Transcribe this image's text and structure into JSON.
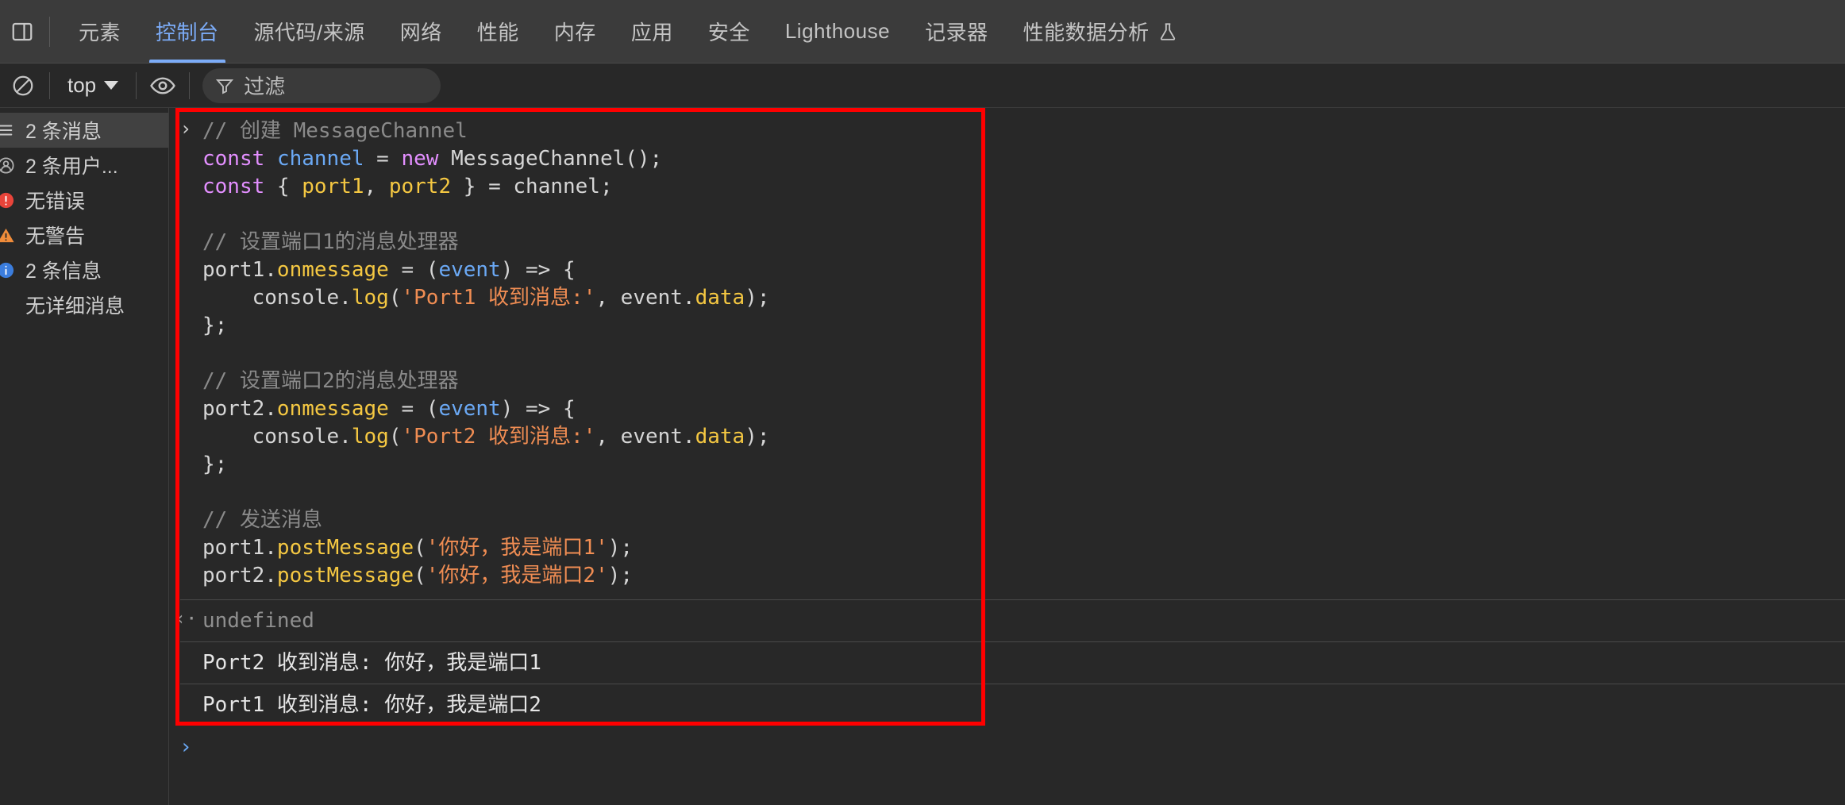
{
  "window": {
    "app": "Chrome DevTools",
    "background": "#282828",
    "accent": "#7cacf8",
    "highlight_color": "#ff0000"
  },
  "tabbar": {
    "dock_icon": "dock-panel-icon",
    "tabs": [
      {
        "label": "元素",
        "name": "tab-elements",
        "selected": false
      },
      {
        "label": "控制台",
        "name": "tab-console",
        "selected": true
      },
      {
        "label": "源代码/来源",
        "name": "tab-sources",
        "selected": false
      },
      {
        "label": "网络",
        "name": "tab-network",
        "selected": false
      },
      {
        "label": "性能",
        "name": "tab-performance",
        "selected": false
      },
      {
        "label": "内存",
        "name": "tab-memory",
        "selected": false
      },
      {
        "label": "应用",
        "name": "tab-application",
        "selected": false
      },
      {
        "label": "安全",
        "name": "tab-security",
        "selected": false
      },
      {
        "label": "Lighthouse",
        "name": "tab-lighthouse",
        "selected": false
      },
      {
        "label": "记录器",
        "name": "tab-recorder",
        "selected": false
      },
      {
        "label": "性能数据分析",
        "name": "tab-performance-insights",
        "selected": false,
        "icon": "flask-icon"
      }
    ]
  },
  "toolbar": {
    "clear_icon": "clear-console-icon",
    "context_value": "top",
    "context_caret": "chevron-down-icon",
    "eye_icon": "live-expression-eye-icon",
    "filter_icon": "filter-funnel-icon",
    "filter_placeholder": "过滤"
  },
  "sidebar": {
    "items": [
      {
        "label": "2 条消息",
        "name": "sidebar-item-messages",
        "icon": "list-icon",
        "selected": true
      },
      {
        "label": "2 条用户...",
        "name": "sidebar-item-user",
        "icon": "user-icon",
        "selected": false
      },
      {
        "label": "无错误",
        "name": "sidebar-item-errors",
        "icon": "error-icon",
        "selected": false
      },
      {
        "label": "无警告",
        "name": "sidebar-item-warnings",
        "icon": "warning-icon",
        "selected": false
      },
      {
        "label": "2 条信息",
        "name": "sidebar-item-info",
        "icon": "info-icon",
        "selected": false
      },
      {
        "label": "无详细消息",
        "name": "sidebar-item-verbose",
        "icon": "none",
        "selected": false
      }
    ]
  },
  "console": {
    "input_chevron": "›",
    "output_chevron": "‹·",
    "prompt_chevron": "›",
    "code_lines": [
      [
        {
          "t": "// 创建 MessageChannel",
          "c": "comment"
        }
      ],
      [
        {
          "t": "const",
          "c": "kw"
        },
        {
          "t": " ",
          "c": "plain"
        },
        {
          "t": "channel",
          "c": "ident"
        },
        {
          "t": " = ",
          "c": "plain"
        },
        {
          "t": "new",
          "c": "kw"
        },
        {
          "t": " MessageChannel();",
          "c": "plain"
        }
      ],
      [
        {
          "t": "const",
          "c": "kw"
        },
        {
          "t": " { ",
          "c": "plain"
        },
        {
          "t": "port1",
          "c": "prop"
        },
        {
          "t": ", ",
          "c": "plain"
        },
        {
          "t": "port2",
          "c": "prop"
        },
        {
          "t": " } = channel;",
          "c": "plain"
        }
      ],
      [
        {
          "t": " ",
          "c": "plain"
        }
      ],
      [
        {
          "t": "// 设置端口1的消息处理器",
          "c": "comment"
        }
      ],
      [
        {
          "t": "port1.",
          "c": "plain"
        },
        {
          "t": "onmessage",
          "c": "prop"
        },
        {
          "t": " = (",
          "c": "plain"
        },
        {
          "t": "event",
          "c": "ident"
        },
        {
          "t": ") => {",
          "c": "plain"
        }
      ],
      [
        {
          "t": "    console.",
          "c": "plain"
        },
        {
          "t": "log",
          "c": "prop"
        },
        {
          "t": "(",
          "c": "plain"
        },
        {
          "t": "'Port1 收到消息:'",
          "c": "str"
        },
        {
          "t": ", event.",
          "c": "plain"
        },
        {
          "t": "data",
          "c": "prop"
        },
        {
          "t": ");",
          "c": "plain"
        }
      ],
      [
        {
          "t": "};",
          "c": "plain"
        }
      ],
      [
        {
          "t": " ",
          "c": "plain"
        }
      ],
      [
        {
          "t": "// 设置端口2的消息处理器",
          "c": "comment"
        }
      ],
      [
        {
          "t": "port2.",
          "c": "plain"
        },
        {
          "t": "onmessage",
          "c": "prop"
        },
        {
          "t": " = (",
          "c": "plain"
        },
        {
          "t": "event",
          "c": "ident"
        },
        {
          "t": ") => {",
          "c": "plain"
        }
      ],
      [
        {
          "t": "    console.",
          "c": "plain"
        },
        {
          "t": "log",
          "c": "prop"
        },
        {
          "t": "(",
          "c": "plain"
        },
        {
          "t": "'Port2 收到消息:'",
          "c": "str"
        },
        {
          "t": ", event.",
          "c": "plain"
        },
        {
          "t": "data",
          "c": "prop"
        },
        {
          "t": ");",
          "c": "plain"
        }
      ],
      [
        {
          "t": "};",
          "c": "plain"
        }
      ],
      [
        {
          "t": " ",
          "c": "plain"
        }
      ],
      [
        {
          "t": "// 发送消息",
          "c": "comment"
        }
      ],
      [
        {
          "t": "port1.",
          "c": "plain"
        },
        {
          "t": "postMessage",
          "c": "prop"
        },
        {
          "t": "(",
          "c": "plain"
        },
        {
          "t": "'你好，我是端口1'",
          "c": "str"
        },
        {
          "t": ");",
          "c": "plain"
        }
      ],
      [
        {
          "t": "port2.",
          "c": "plain"
        },
        {
          "t": "postMessage",
          "c": "prop"
        },
        {
          "t": "(",
          "c": "plain"
        },
        {
          "t": "'你好，我是端口2'",
          "c": "str"
        },
        {
          "t": ");",
          "c": "plain"
        }
      ]
    ],
    "outputs": [
      {
        "text": "undefined",
        "kind": "result",
        "name": "console-result-undefined"
      },
      {
        "text": "Port2 收到消息: 你好，我是端口1",
        "kind": "log",
        "name": "console-log-port2"
      },
      {
        "text": "Port1 收到消息: 你好，我是端口2",
        "kind": "log",
        "name": "console-log-port1"
      }
    ]
  }
}
